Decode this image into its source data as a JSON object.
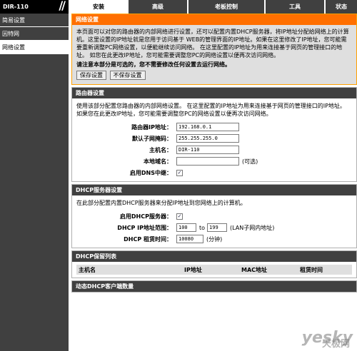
{
  "header": {
    "model": "DIR-110",
    "tabs": [
      "安装",
      "高级",
      "老板控制",
      "工具",
      "状态"
    ],
    "active_tab": 0
  },
  "sidebar": {
    "items": [
      {
        "label": "简易设置"
      },
      {
        "label": "因特网"
      },
      {
        "label": "网络设置"
      }
    ],
    "active_index": 2
  },
  "network_settings": {
    "title": "网络设置",
    "description": "本页面可以对您的路由器的内部网络进行设置，还可以配置内置DHCP服务器，将IP地址分配给网络上的计算机。这里设置的IP地址就是您用于访问基于 WEB的管理界面的IP地址。如果在这里修改了IP地址，您可能需要重新调整PC网络设置，以便能继续访问网络。 在这里配置的IP地址为用来连接基于网页的管理接口的地址。 如您在此更改IP地址，您可能需要调整您PC的网络设置以便再次访问网络。",
    "note": "请注意本部分是可选的，您不需要修改任何设置去运行网络。",
    "save_button": "保存设置",
    "dont_save_button": "不保存设置"
  },
  "router_settings": {
    "title": "路由器设置",
    "description": "使用该部分配置您路由器的内部网络设置。 在这里配置的IP地址为用来连接基于网页的管理接口的IP地址。 如果您在此更改IP地址，您可能需要调整您PC的网络设置以便再次访问网络。",
    "ip_label": "路由器IP地址：",
    "ip_value": "192.168.0.1",
    "mask_label": "默认子网掩码：",
    "mask_value": "255.255.255.0",
    "hostname_label": "主机名：",
    "hostname_value": "DIR-110",
    "domain_label": "本地域名：",
    "domain_value": "",
    "domain_hint": "(可选)",
    "dns_relay_label": "启用DNS中继：",
    "dns_relay_checked": true
  },
  "dhcp_server": {
    "title": "DHCP服务器设置",
    "description": "在此部分配置内置DHCP服务器来分配IP地址到您网络上的计算机。",
    "enable_label": "启用DHCP服务器：",
    "enable_checked": true,
    "range_label": "DHCP IP地址范围：",
    "range_start": "100",
    "range_to": "to",
    "range_end": "199",
    "range_hint": "(LAN子网内地址)",
    "lease_label": "DHCP 租赁时间：",
    "lease_value": "10080",
    "lease_unit": "(分钟)"
  },
  "dhcp_reservation": {
    "title": "DHCP保留列表",
    "columns": [
      "主机名",
      "IP地址",
      "MAC地址",
      "租赁时间"
    ]
  },
  "dynamic_clients": {
    "title": "动态DHCP客户端数量"
  },
  "watermark": {
    "text": "yesky",
    "sub": "天极网"
  }
}
